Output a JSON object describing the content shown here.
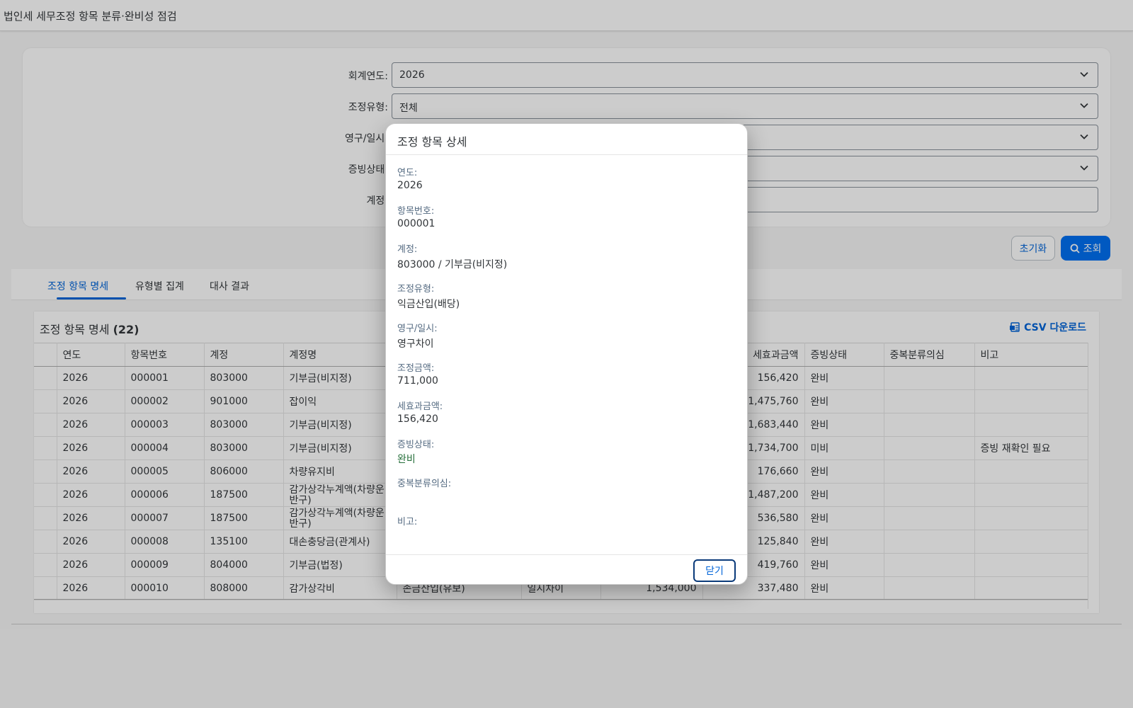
{
  "header": {
    "title": "법인세 세무조정 항목 분류·완비성 점검"
  },
  "filters": {
    "year_label": "회계연도:",
    "year_value": "2026",
    "type_label": "조정유형:",
    "type_value": "전체",
    "perm_label": "영구/일시:",
    "perm_value": "",
    "evidence_label": "증빙상태:",
    "evidence_value": "",
    "account_label": "계정:",
    "account_value": ""
  },
  "actions": {
    "reset_label": "초기화",
    "search_label": "조회"
  },
  "tabs": [
    {
      "label": "조정 항목 명세"
    },
    {
      "label": "유형별 집계"
    },
    {
      "label": "대사 결과"
    }
  ],
  "table": {
    "title": "조정 항목 명세",
    "count": "(22)",
    "csv_label": "CSV 다운로드",
    "columns": [
      "연도",
      "항목번호",
      "계정",
      "계정명",
      "",
      "",
      "",
      "세효과금액",
      "증빙상태",
      "중복분류의심",
      "비고"
    ],
    "rows": [
      {
        "year": "2026",
        "no": "000001",
        "acct": "803000",
        "name": "기부금(비지정)",
        "type": "",
        "perm": "",
        "amt": "",
        "tax": "156,420",
        "ev": "완비",
        "ev_status": "ok",
        "dup": "",
        "note": ""
      },
      {
        "year": "2026",
        "no": "000002",
        "acct": "901000",
        "name": "잡이익",
        "type": "",
        "perm": "",
        "amt": "",
        "tax": "1,475,760",
        "ev": "완비",
        "ev_status": "ok",
        "dup": "",
        "note": ""
      },
      {
        "year": "2026",
        "no": "000003",
        "acct": "803000",
        "name": "기부금(비지정)",
        "type": "",
        "perm": "",
        "amt": "",
        "tax": "1,683,440",
        "ev": "완비",
        "ev_status": "ok",
        "dup": "",
        "note": ""
      },
      {
        "year": "2026",
        "no": "000004",
        "acct": "803000",
        "name": "기부금(비지정)",
        "type": "",
        "perm": "",
        "amt": "",
        "tax": "1,734,700",
        "ev": "미비",
        "ev_status": "bad",
        "dup": "",
        "note": "증빙 재확인 필요"
      },
      {
        "year": "2026",
        "no": "000005",
        "acct": "806000",
        "name": "차량유지비",
        "type": "",
        "perm": "",
        "amt": "",
        "tax": "176,660",
        "ev": "완비",
        "ev_status": "ok",
        "dup": "",
        "note": ""
      },
      {
        "year": "2026",
        "no": "000006",
        "acct": "187500",
        "name": "감가상각누계액(차량운반구)",
        "type": "",
        "perm": "",
        "amt": "",
        "tax": "1,487,200",
        "ev": "완비",
        "ev_status": "ok",
        "dup": "",
        "note": ""
      },
      {
        "year": "2026",
        "no": "000007",
        "acct": "187500",
        "name": "감가상각누계액(차량운반구)",
        "type": "",
        "perm": "",
        "amt": "",
        "tax": "536,580",
        "ev": "완비",
        "ev_status": "ok",
        "dup": "",
        "note": ""
      },
      {
        "year": "2026",
        "no": "000008",
        "acct": "135100",
        "name": "대손충당금(관계사)",
        "type": "",
        "perm": "",
        "amt": "",
        "tax": "125,840",
        "ev": "완비",
        "ev_status": "ok",
        "dup": "",
        "note": ""
      },
      {
        "year": "2026",
        "no": "000009",
        "acct": "804000",
        "name": "기부금(법정)",
        "type": "",
        "perm": "",
        "amt": "",
        "tax": "419,760",
        "ev": "완비",
        "ev_status": "ok",
        "dup": "",
        "note": ""
      },
      {
        "year": "2026",
        "no": "000010",
        "acct": "808000",
        "name": "감가상각비",
        "type": "손금산입(유보)",
        "perm": "일시차이",
        "amt": "1,534,000",
        "tax": "337,480",
        "ev": "완비",
        "ev_status": "ok",
        "dup": "",
        "note": ""
      }
    ]
  },
  "dialog": {
    "title": "조정 항목 상세",
    "fields": [
      {
        "label": "연도:",
        "value": "2026"
      },
      {
        "label": "항목번호:",
        "value": "000001"
      },
      {
        "label": "계정:",
        "value": "803000 / 기부금(비지정)"
      },
      {
        "label": "조정유형:",
        "value": "익금산입(배당)"
      },
      {
        "label": "영구/일시:",
        "value": "영구차이"
      },
      {
        "label": "조정금액:",
        "value": "711,000"
      },
      {
        "label": "세효과금액:",
        "value": "156,420"
      },
      {
        "label": "증빙상태:",
        "value": "완비"
      },
      {
        "label": "중복분류의심:",
        "value": ""
      },
      {
        "label": "비고:",
        "value": ""
      }
    ],
    "close_label": "닫기"
  },
  "colors": {
    "accent": "#0064d9",
    "ok": "#256f3a",
    "bad": "#aa0808"
  }
}
